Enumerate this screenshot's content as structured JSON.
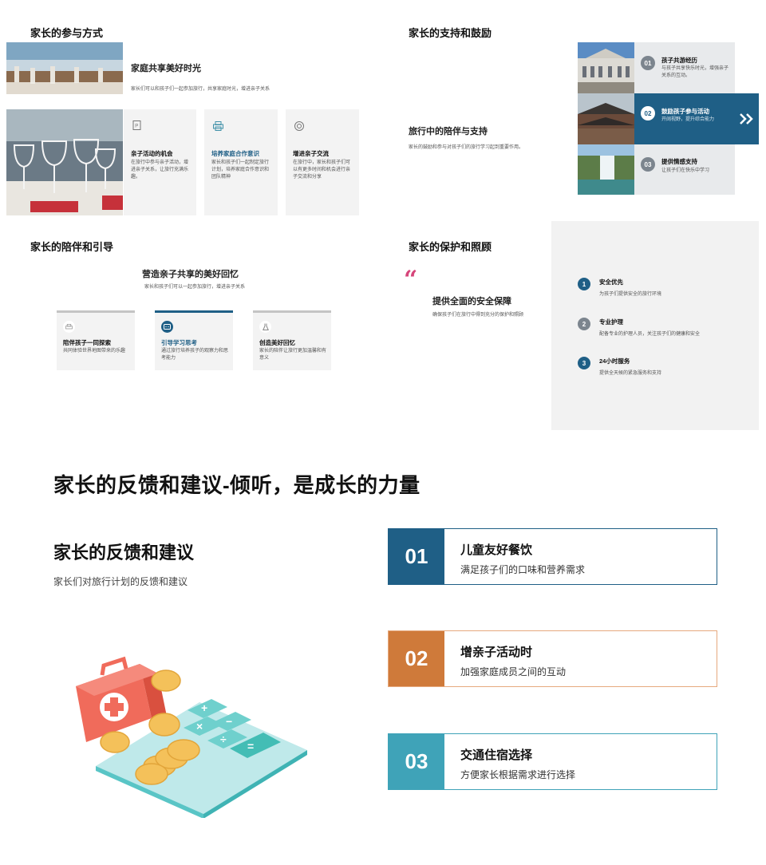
{
  "participation": {
    "title": "家长的参与方式",
    "feature_title": "家庭共享美好时光",
    "feature_desc": "家长们可以和孩子们一起参加旅行，共享家庭时光，增进亲子关系",
    "cards": [
      {
        "icon": "document-icon",
        "title": "亲子活动的机会",
        "desc": "在旅行中参与亲子活动，增进亲子关系，让旅行充满乐趣。"
      },
      {
        "icon": "printer-icon",
        "title": "培养家庭合作意识",
        "desc": "家长和孩子们一起制定旅行计划，培养家庭合作意识和团队精神"
      },
      {
        "icon": "target-icon",
        "title": "增进亲子交流",
        "desc": "在旅行中，家长和孩子们可以有更多时间和机会进行亲子交流和分享"
      }
    ]
  },
  "support": {
    "title": "家长的支持和鼓励",
    "sub_title": "旅行中的陪伴与支持",
    "sub_desc": "家长的鼓励和参与对孩子们的旅行学习起到重要作用。",
    "items": [
      {
        "num": "01",
        "title": "孩子共游经历",
        "desc": "与孩子共享快乐时光，增强亲子关系的互动。"
      },
      {
        "num": "02",
        "title": "鼓励孩子参与活动",
        "desc": "开阔视野，提升综合能力"
      },
      {
        "num": "03",
        "title": "提供情感支持",
        "desc": "让孩子们在快乐中学习"
      }
    ],
    "arrow_icon": "double-chevron-right-icon"
  },
  "companion": {
    "title": "家长的陪伴和引导",
    "center_title": "营造亲子共享的美好回忆",
    "center_desc": "家长和孩子们可以一起参加旅行，增进亲子关系",
    "cards": [
      {
        "icon": "printer-icon",
        "title": "陪伴孩子一同探索",
        "desc": "共同体验世界地图带来的乐趣"
      },
      {
        "icon": "chat-icon",
        "title": "引导学习思考",
        "desc": "通过旅行培养孩子的观察力和思考能力"
      },
      {
        "icon": "flask-icon",
        "title": "创造美好回忆",
        "desc": "家长的陪伴让旅行更加温馨和有意义"
      }
    ]
  },
  "protection": {
    "title": "家长的保护和照顾",
    "quote_mark": "“",
    "quote_title": "提供全面的安全保障",
    "quote_desc": "确保孩子们在旅行中得到充分的保护和照顾",
    "items": [
      {
        "num": "1",
        "title": "安全优先",
        "desc": "为孩子们提供安全的旅行环境"
      },
      {
        "num": "2",
        "title": "专业护理",
        "desc": "配备专业的护理人员，关注孩子们的健康和安全"
      },
      {
        "num": "3",
        "title": "24小时服务",
        "desc": "提供全天候的紧急服务和支持"
      }
    ]
  },
  "feedback": {
    "headline": "家长的反馈和建议-倾听，是成长的力量",
    "title": "家长的反馈和建议",
    "subtitle": "家长们对旅行计划的反馈和建议",
    "items": [
      {
        "num": "01",
        "title": "儿童友好餐饮",
        "desc": "满足孩子们的口味和营养需求",
        "color": "#1f5f86"
      },
      {
        "num": "02",
        "title": "增亲子活动时",
        "desc": "加强家庭成员之间的互动",
        "color": "#cf7a3a"
      },
      {
        "num": "03",
        "title": "交通住宿选择",
        "desc": "方便家长根据需求进行选择",
        "color": "#3fa3b8"
      }
    ]
  },
  "colors": {
    "primary": "#1f5f86",
    "grey_dark": "#7c858e",
    "pink": "#d6457a",
    "orange": "#cf7a3a",
    "teal": "#3fa3b8"
  }
}
